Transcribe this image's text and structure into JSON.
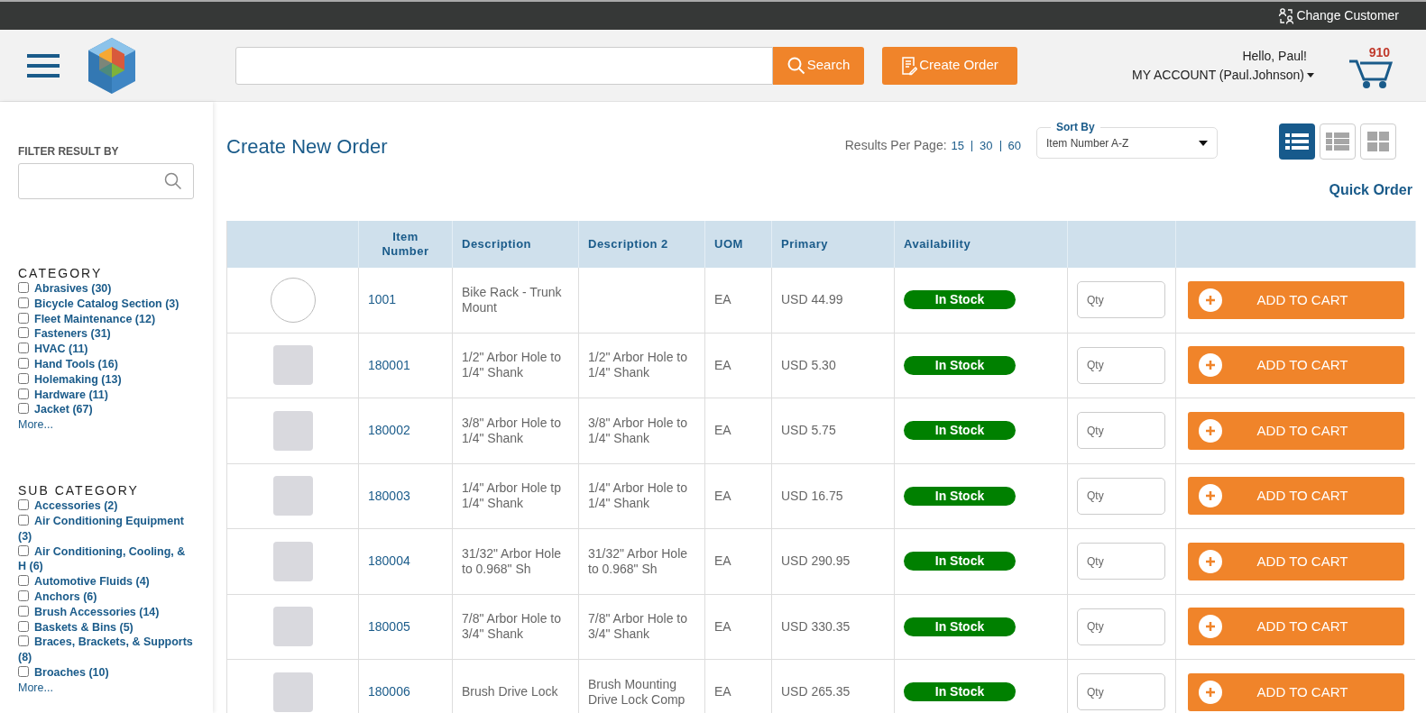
{
  "top_bar": {
    "change_customer": "Change Customer"
  },
  "header": {
    "search_button": "Search",
    "create_order_button": "Create Order",
    "greeting": "Hello, Paul!",
    "account": "MY ACCOUNT (Paul.Johnson)",
    "cart_count": "910"
  },
  "sidebar": {
    "filter_label": "FILTER RESULT BY",
    "sections": [
      {
        "title": "CATEGORY",
        "more": "More...",
        "items": [
          {
            "label": "Abrasives (30)",
            "checked": false
          },
          {
            "label": "Bicycle Catalog Section (3)",
            "checked": false
          },
          {
            "label": "Fleet Maintenance (12)",
            "checked": false
          },
          {
            "label": "Fasteners (31)",
            "checked": false
          },
          {
            "label": "HVAC (11)",
            "checked": false
          },
          {
            "label": "Hand Tools (16)",
            "checked": false
          },
          {
            "label": "Holemaking (13)",
            "checked": false
          },
          {
            "label": "Hardware (11)",
            "checked": false
          },
          {
            "label": "Jacket (67)",
            "checked": false
          }
        ]
      },
      {
        "title": "SUB CATEGORY",
        "more": "More...",
        "items": [
          {
            "label": "Accessories (2)",
            "checked": false
          },
          {
            "label": "Air Conditioning Equipment (3)",
            "checked": false
          },
          {
            "label": "Air Conditioning, Cooling, & H (6)",
            "checked": false
          },
          {
            "label": "Automotive Fluids (4)",
            "checked": false
          },
          {
            "label": "Anchors (6)",
            "checked": false
          },
          {
            "label": "Brush Accessories (14)",
            "checked": false
          },
          {
            "label": "Baskets & Bins (5)",
            "checked": false
          },
          {
            "label": "Braces, Brackets, & Supports (8)",
            "checked": false
          },
          {
            "label": "Broaches (10)",
            "checked": false
          }
        ]
      }
    ]
  },
  "main": {
    "title": "Create New Order",
    "results_label": "Results Per Page:",
    "results_options": [
      "15",
      "30",
      "60"
    ],
    "sort": {
      "legend": "Sort By",
      "value": "Item Number A-Z"
    },
    "views": [
      {
        "kind": "list",
        "selected": true
      },
      {
        "kind": "rows",
        "selected": false
      },
      {
        "kind": "grid",
        "selected": false
      }
    ],
    "quick_order": "Quick Order"
  },
  "table": {
    "columns": [
      "",
      "Item Number",
      "Description",
      "Description 2",
      "UOM",
      "Primary",
      "Availability",
      "",
      ""
    ],
    "rows": [
      {
        "kind": "no_image",
        "item": "1001",
        "description": "Bike Rack - Trunk Mount",
        "description_2": "",
        "uom": "EA",
        "price": "USD 44.99",
        "availability": "In Stock",
        "in_stock": true,
        "qty_placeholder": "Qty",
        "button": "ADD TO CART"
      },
      {
        "kind": "photo",
        "item": "180001",
        "description": "1/2\" Arbor Hole to 1/4\" Shank",
        "description_2": "1/2\" Arbor Hole to 1/4\" Shank",
        "uom": "EA",
        "price": "USD 5.30",
        "availability": "In Stock",
        "in_stock": true,
        "qty_placeholder": "Qty",
        "button": "ADD TO CART"
      },
      {
        "kind": "photo",
        "item": "180002",
        "description": "3/8\" Arbor Hole to 1/4\" Shank",
        "description_2": "3/8\" Arbor Hole to 1/4\" Shank",
        "uom": "EA",
        "price": "USD 5.75",
        "availability": "In Stock",
        "in_stock": true,
        "qty_placeholder": "Qty",
        "button": "ADD TO CART"
      },
      {
        "kind": "photo",
        "item": "180003",
        "description": "1/4\" Arbor Hole tp 1/4\" Shank",
        "description_2": "1/4\" Arbor Hole to 1/4\" Shank",
        "uom": "EA",
        "price": "USD 16.75",
        "availability": "In Stock",
        "in_stock": true,
        "qty_placeholder": "Qty",
        "button": "ADD TO CART"
      },
      {
        "kind": "photo",
        "item": "180004",
        "description": "31/32\" Arbor Hole to 0.968\" Sh",
        "description_2": "31/32\" Arbor Hole to 0.968\" Sh",
        "uom": "EA",
        "price": "USD 290.95",
        "availability": "In Stock",
        "in_stock": true,
        "qty_placeholder": "Qty",
        "button": "ADD TO CART"
      },
      {
        "kind": "photo",
        "item": "180005",
        "description": "7/8\" Arbor Hole to 3/4\" Shank",
        "description_2": "7/8\" Arbor Hole to 3/4\" Shank",
        "uom": "EA",
        "price": "USD 330.35",
        "availability": "In Stock",
        "in_stock": true,
        "qty_placeholder": "Qty",
        "button": "ADD TO CART"
      },
      {
        "kind": "photo",
        "item": "180006",
        "description": "Brush Drive Lock",
        "description_2": "Brush Mounting Drive Lock Comp",
        "uom": "EA",
        "price": "USD 265.35",
        "availability": "In Stock",
        "in_stock": true,
        "qty_placeholder": "Qty",
        "button": "ADD TO CART"
      }
    ]
  }
}
